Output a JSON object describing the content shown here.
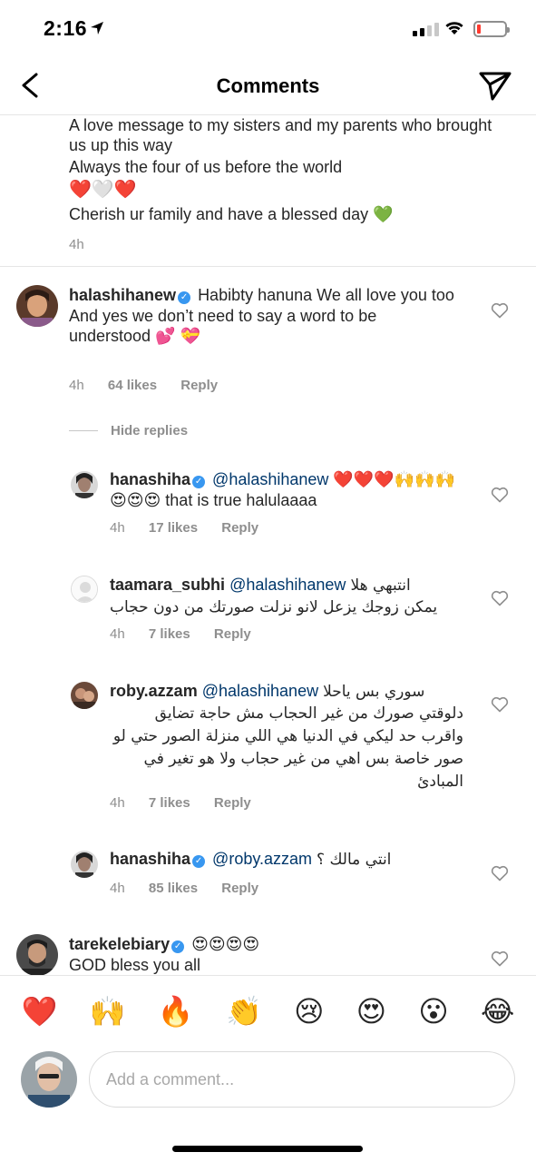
{
  "status_bar": {
    "time": "2:16"
  },
  "header": {
    "title": "Comments"
  },
  "caption": {
    "lines": [
      "A love message to my sisters and my parents who brought us up this way",
      "Always the four of us before the world",
      "❤️🤍❤️",
      "Cherish ur family and have a blessed day 💚"
    ],
    "time": "4h"
  },
  "comments": [
    {
      "username": "halashihanew",
      "text": "Habibty hanuna We all love you too",
      "text2": "And yes we don’t need to say a word to be understood 💕 💝",
      "time": "4h",
      "likes": "64 likes",
      "reply": "Reply"
    }
  ],
  "hide_replies": "Hide replies",
  "replies": [
    {
      "username": "hanashiha",
      "mention": "@halashihanew",
      "text": "❤️❤️❤️🙌🙌🙌😍😍😍 that is true halulaaaa",
      "time": "4h",
      "likes": "17 likes",
      "reply": "Reply"
    },
    {
      "username": "taamara_subhi",
      "mention": "@halashihanew",
      "text": "انتبهي هلا",
      "text2": "يمكن زوجك يزعل لانو نزلت صورتك من دون حجاب",
      "time": "4h",
      "likes": "7 likes",
      "reply": "Reply"
    },
    {
      "username": "roby.azzam",
      "mention": "@halashihanew",
      "text": "سوري بس ياحلا",
      "text2": "دلوقتي صورك من غير الحجاب مش حاجة تضايق واقرب حد ليكي في الدنيا هي اللي منزلة الصور حتي لو صور خاصة بس اهي من غير حجاب ولا هو تغير في المبادئ",
      "time": "4h",
      "likes": "7 likes",
      "reply": "Reply"
    },
    {
      "username": "hanashiha",
      "mention": "@roby.azzam",
      "text": "انتي مالك ؟",
      "time": "4h",
      "likes": "85 likes",
      "reply": "Reply"
    }
  ],
  "last_comment": {
    "username": "tarekelebiary",
    "text": "😍😍😍😍",
    "text2": "GOD bless you all"
  },
  "emoji_bar": [
    "❤️",
    "🙌",
    "🔥",
    "👏",
    "😢",
    "😍",
    "😮",
    "😂"
  ],
  "composer": {
    "placeholder": "Add a comment..."
  },
  "colors": {
    "link": "#00376b",
    "verified": "#3897f0",
    "meta": "#8e8e8e"
  }
}
